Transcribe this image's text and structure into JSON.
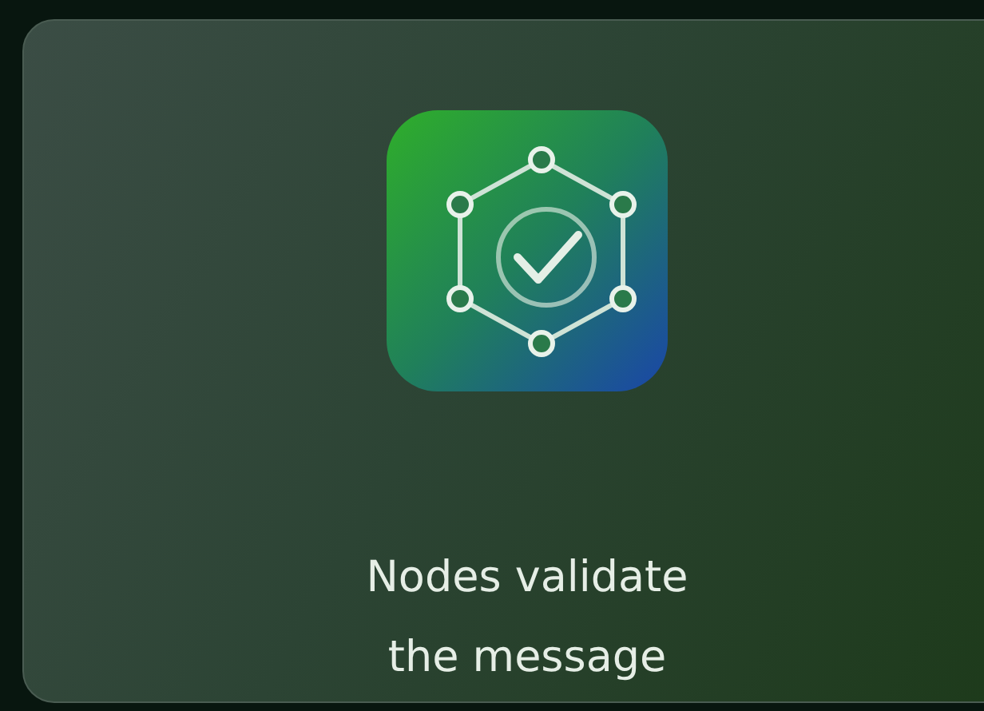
{
  "card": {
    "text": "Nodes validate the message"
  }
}
